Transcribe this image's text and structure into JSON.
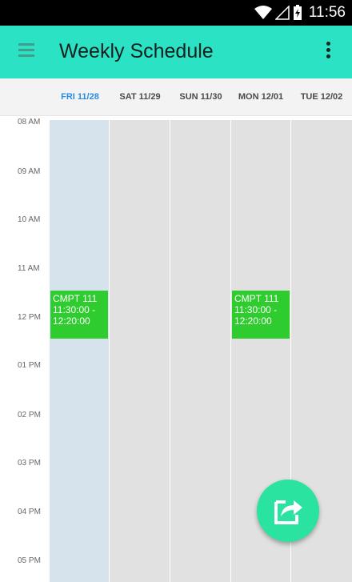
{
  "status_bar": {
    "time": "11:56",
    "icons": [
      "wifi-icon",
      "signal-icon",
      "battery-charging-icon"
    ]
  },
  "app_bar": {
    "title": "Weekly Schedule",
    "menu_icon": "menu-icon",
    "overflow_icon": "more-vert-icon"
  },
  "days": [
    {
      "label": "FRI 11/28",
      "active": true
    },
    {
      "label": "SAT 11/29",
      "active": false
    },
    {
      "label": "SUN 11/30",
      "active": false
    },
    {
      "label": "MON 12/01",
      "active": false
    },
    {
      "label": "TUE 12/02",
      "active": false
    }
  ],
  "hours": [
    "08 AM",
    "09 AM",
    "10 AM",
    "11 AM",
    "12 PM",
    "01 PM",
    "02 PM",
    "03 PM",
    "04 PM",
    "05 PM"
  ],
  "events": [
    {
      "day": "FRI 11/28",
      "title": "CMPT 111",
      "start": "11:30:00 -",
      "end": "12:20:00"
    },
    {
      "day": "MON 12/01",
      "title": "CMPT 111",
      "start": "11:30:00 -",
      "end": "12:20:00"
    }
  ],
  "fab": {
    "icon": "share-icon"
  },
  "colors": {
    "app_bar": "#2be3c4",
    "event": "#2ecc2e",
    "today_column": "#d6e3ec",
    "active_day": "#2a8be6",
    "fab": "#2be3a0"
  }
}
